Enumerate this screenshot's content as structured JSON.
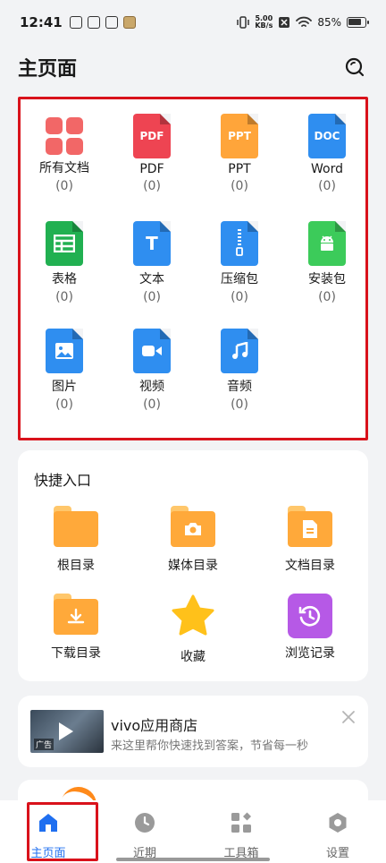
{
  "status_bar": {
    "time": "12:41",
    "speed_value": "5.00",
    "speed_unit": "KB/s",
    "battery": "85%"
  },
  "header": {
    "title": "主页面"
  },
  "categories": [
    {
      "label": "所有文档",
      "count": "(0)",
      "icon": "grid-icon",
      "color": "#f26767"
    },
    {
      "label": "PDF",
      "count": "(0)",
      "icon_text": "PDF",
      "color": "#ee4452"
    },
    {
      "label": "PPT",
      "count": "(0)",
      "icon_text": "PPT",
      "color": "#ffa53a"
    },
    {
      "label": "Word",
      "count": "(0)",
      "icon_text": "DOC",
      "color": "#2f8ef0"
    },
    {
      "label": "表格",
      "count": "(0)",
      "icon": "table-icon",
      "color": "#21b051"
    },
    {
      "label": "文本",
      "count": "(0)",
      "icon_text": "T",
      "color": "#2f8ef0"
    },
    {
      "label": "压缩包",
      "count": "(0)",
      "icon": "zip-icon",
      "color": "#2f8ef0"
    },
    {
      "label": "安装包",
      "count": "(0)",
      "icon": "android-icon",
      "color": "#3ccb5a"
    },
    {
      "label": "图片",
      "count": "(0)",
      "icon": "image-icon",
      "color": "#2f8ef0"
    },
    {
      "label": "视频",
      "count": "(0)",
      "icon": "video-icon",
      "color": "#2f8ef0"
    },
    {
      "label": "音频",
      "count": "(0)",
      "icon": "music-icon",
      "color": "#2f8ef0"
    }
  ],
  "quick": {
    "title": "快捷入口",
    "items": [
      {
        "label": "根目录"
      },
      {
        "label": "媒体目录"
      },
      {
        "label": "文档目录"
      },
      {
        "label": "下载目录"
      },
      {
        "label": "收藏"
      },
      {
        "label": "浏览记录"
      }
    ]
  },
  "ad": {
    "title": "vivo应用商店",
    "desc": "来这里帮你快速找到答案，节省每一秒",
    "tag": "广告"
  },
  "nav": {
    "items": [
      {
        "label": "主页面"
      },
      {
        "label": "近期"
      },
      {
        "label": "工具箱"
      },
      {
        "label": "设置"
      }
    ]
  },
  "colors": {
    "accent": "#1f6ff0",
    "highlight": "#d9121b"
  }
}
